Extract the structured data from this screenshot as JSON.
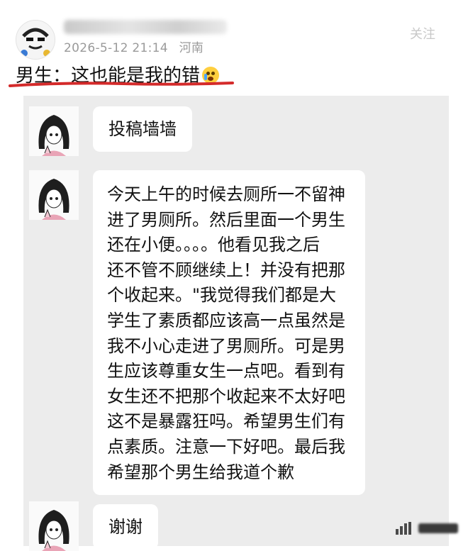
{
  "post": {
    "timestamp": "2026-5-12 21:14",
    "location": "河南",
    "follow_label": "关注",
    "title": "男生：这也能是我的错",
    "title_emoji": "crying-face-emoji"
  },
  "chat": {
    "messages": [
      {
        "lines": [
          "投稿墙墙"
        ]
      },
      {
        "lines": [
          "今天上午的时候去厕所一不留神",
          "进了男厕所。然后里面一个男生",
          "还在小便。。。。他看见我之后",
          "还不管不顾继续上！并没有把那",
          "个收起来。\"我觉得我们都是大",
          "学生了素质都应该高一点虽然是",
          "我不小心走进了男厕所。可是男",
          "生应该尊重女生一点吧。看到有",
          "女生还不把那个收起来不太好吧",
          "这不是暴露狂吗。希望男生们有",
          "点素质。注意一下好吧。最后我",
          "希望那个男生给我道个歉"
        ]
      },
      {
        "lines": [
          "谢谢"
        ]
      }
    ]
  },
  "colors": {
    "underline": "#d42a2a",
    "chat_background": "#ececec",
    "bubble": "#ffffff",
    "meta_text": "#9a9a9a"
  }
}
